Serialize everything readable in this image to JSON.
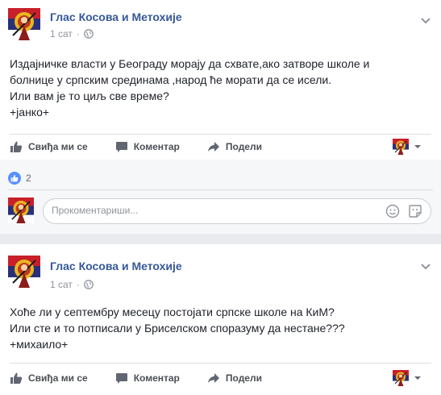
{
  "posts": [
    {
      "page_name": "Глас Косова и Метохије",
      "timestamp": "1 сат",
      "text_lines": [
        "Издајничке власти у Београду морају да схвате,ако затворе школе и",
        "болнице у српским срединама ,народ ће морати да се исели.",
        "Или вам је то циљ све време?",
        "+јанко+"
      ],
      "actions": {
        "like": "Свиђа ми се",
        "comment": "Коментар",
        "share": "Подели"
      },
      "reaction_count": "2",
      "comment_placeholder": "Прокоментариши..."
    },
    {
      "page_name": "Глас Косова и Метохије",
      "timestamp": "1 сат",
      "text_lines": [
        "Хоће ли у септембру месецу постојати српске школе на КиМ?",
        "Или сте и то потписали у Бриселском споразуму да нестане???",
        "+михаило+"
      ],
      "actions": {
        "like": "Свиђа ми се",
        "comment": "Коментар",
        "share": "Подели"
      }
    }
  ],
  "colors": {
    "link_blue": "#365899",
    "like_blue": "#5890ff",
    "action_gray": "#4b4f56",
    "meta_gray": "#90949c",
    "feed_bg": "#e9ebee"
  },
  "icons": [
    "page-avatar-icon",
    "globe-icon",
    "chevron-down-icon",
    "like-icon",
    "comment-icon",
    "share-icon",
    "like-reaction-icon",
    "emoji-icon",
    "sticker-icon"
  ]
}
